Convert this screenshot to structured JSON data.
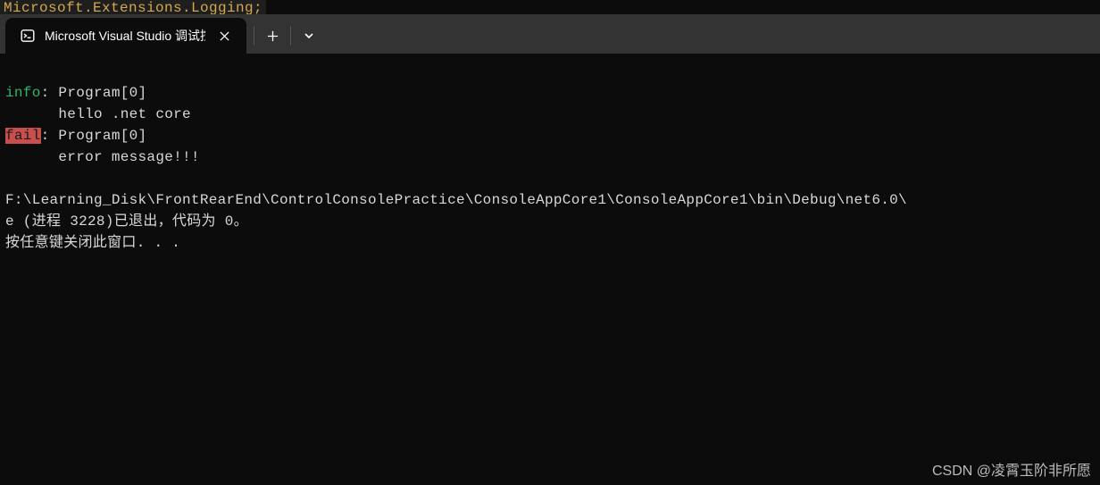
{
  "peek_line": "Microsoft.Extensions.Logging;",
  "tab": {
    "title": "Microsoft Visual Studio 调试控",
    "icon_name": "terminal-icon"
  },
  "colors": {
    "info": "#2fb46a",
    "fail_bg": "#c94f4f",
    "fail_fg": "#1a1a1a",
    "text": "#d8d8d8",
    "bg": "#0c0c0c"
  },
  "log": {
    "l1_level": "info",
    "l1_rest": ": Program[0]",
    "l2": "      hello .net core",
    "l3_level": "fail",
    "l3_rest": ": Program[0]",
    "l4": "      error message!!!",
    "blank": "",
    "path": "F:\\Learning_Disk\\FrontRearEnd\\ControlConsolePractice\\ConsoleAppCore1\\ConsoleAppCore1\\bin\\Debug\\net6.0\\",
    "exit": "e (进程 3228)已退出，代码为 0。",
    "prompt": "按任意键关闭此窗口. . ."
  },
  "watermark": "CSDN @凌霄玉阶非所愿"
}
